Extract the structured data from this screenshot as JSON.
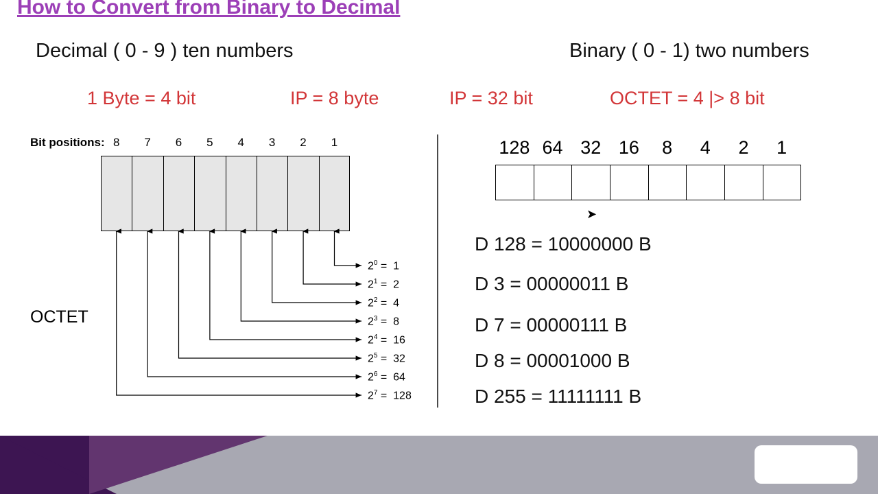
{
  "title": "How to Convert from Binary to Decimal",
  "subtitle_left": "Decimal ( 0 - 9 ) ten numbers",
  "subtitle_right": "Binary ( 0 - 1) two numbers",
  "red": {
    "byte": "1 Byte = 4 bit",
    "ip_byte": "IP = 8 byte",
    "ip_bit": "IP = 32 bit",
    "octet": "OCTET =  4 |> 8 bit"
  },
  "bit_positions_label": "Bit positions:",
  "bit_positions": [
    "8",
    "7",
    "6",
    "5",
    "4",
    "3",
    "2",
    "1"
  ],
  "octet_label": "OCTET",
  "powers": [
    {
      "exp": "0",
      "val": "1"
    },
    {
      "exp": "1",
      "val": "2"
    },
    {
      "exp": "2",
      "val": "4"
    },
    {
      "exp": "3",
      "val": "8"
    },
    {
      "exp": "4",
      "val": "16"
    },
    {
      "exp": "5",
      "val": "32"
    },
    {
      "exp": "6",
      "val": "64"
    },
    {
      "exp": "7",
      "val": "128"
    }
  ],
  "place_values": [
    "128",
    "64",
    "32",
    "16",
    "8",
    "4",
    "2",
    "1"
  ],
  "conversions": [
    "D 128 = 10000000 B",
    "D 3     = 00000011 B",
    "D 7     = 00000111 B",
    "D 8     = 00001000 B",
    "D 255 = 11111111 B"
  ]
}
